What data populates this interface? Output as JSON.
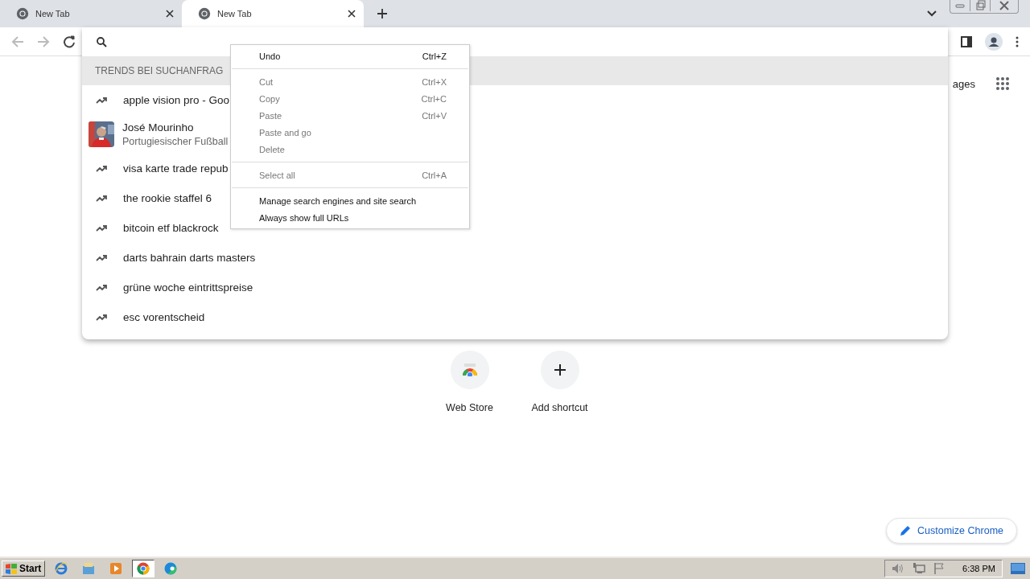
{
  "tabs": [
    {
      "title": "New Tab",
      "selected": false
    },
    {
      "title": "New Tab",
      "selected": true
    }
  ],
  "dropdown": {
    "header": "TRENDS BEI SUCHANFRAG",
    "suggestions": [
      {
        "kind": "trend",
        "text": "apple vision pro - Goo"
      },
      {
        "kind": "entity",
        "text": "José Mourinho",
        "subtitle": "Portugiesischer Fußball"
      },
      {
        "kind": "trend",
        "text": "visa karte trade repub"
      },
      {
        "kind": "trend",
        "text": "the rookie staffel 6"
      },
      {
        "kind": "trend",
        "text": "bitcoin etf blackrock"
      },
      {
        "kind": "trend",
        "text": "darts bahrain darts masters"
      },
      {
        "kind": "trend",
        "text": "grüne woche eintrittspreise"
      },
      {
        "kind": "trend",
        "text": "esc vorentscheid"
      }
    ]
  },
  "context_menu": [
    {
      "kind": "item",
      "label": "Undo",
      "shortcut": "Ctrl+Z",
      "disabled": false
    },
    {
      "kind": "separator"
    },
    {
      "kind": "item",
      "label": "Cut",
      "shortcut": "Ctrl+X",
      "disabled": true
    },
    {
      "kind": "item",
      "label": "Copy",
      "shortcut": "Ctrl+C",
      "disabled": true
    },
    {
      "kind": "item",
      "label": "Paste",
      "shortcut": "Ctrl+V",
      "disabled": true
    },
    {
      "kind": "item",
      "label": "Paste and go",
      "disabled": true
    },
    {
      "kind": "item",
      "label": "Delete",
      "disabled": true
    },
    {
      "kind": "separator"
    },
    {
      "kind": "item",
      "label": "Select all",
      "shortcut": "Ctrl+A",
      "disabled": true
    },
    {
      "kind": "separator"
    },
    {
      "kind": "item",
      "label": "Manage search engines and site search",
      "disabled": false
    },
    {
      "kind": "item",
      "label": "Always show full URLs",
      "disabled": false
    }
  ],
  "page": {
    "images_link": "ages",
    "shortcuts": [
      {
        "kind": "webstore",
        "label": "Web Store"
      },
      {
        "kind": "add",
        "label": "Add shortcut"
      }
    ],
    "customize_button": "Customize Chrome"
  },
  "taskbar": {
    "start": "Start",
    "apps": [
      {
        "kind": "ie",
        "selected": false
      },
      {
        "kind": "folder",
        "selected": false
      },
      {
        "kind": "media",
        "selected": false
      },
      {
        "kind": "chrome",
        "selected": true
      },
      {
        "kind": "edge",
        "selected": false
      }
    ],
    "clock": "6:38 PM"
  }
}
